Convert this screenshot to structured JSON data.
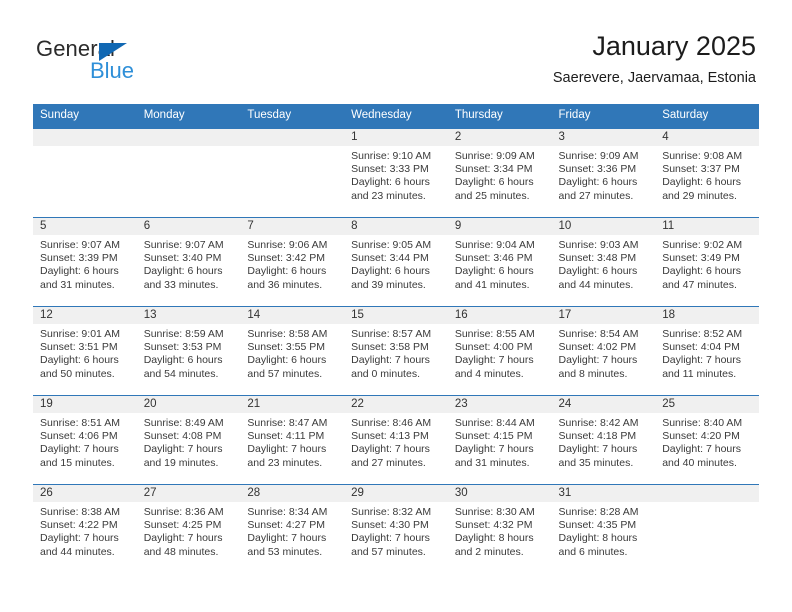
{
  "logo": {
    "text_top": "General",
    "text_bottom": "Blue",
    "triangle_color": "#1168b3",
    "blue_color": "#2e8fd8"
  },
  "header": {
    "title": "January 2025",
    "subtitle": "Saerevere, Jaervamaa, Estonia"
  },
  "theme": {
    "header_blue": "#3077b8",
    "daynum_band": "#f0f0f0",
    "text": "#3a3a3a"
  },
  "weekdays": [
    "Sunday",
    "Monday",
    "Tuesday",
    "Wednesday",
    "Thursday",
    "Friday",
    "Saturday"
  ],
  "labels": {
    "sunrise_prefix": "Sunrise:",
    "sunset_prefix": "Sunset:",
    "daylight_prefix": "Daylight:"
  },
  "weeks": [
    [
      {
        "day": "",
        "empty": true,
        "sunrise": "",
        "sunset": "",
        "daylight_line1": "",
        "daylight_line2": ""
      },
      {
        "day": "",
        "empty": true,
        "sunrise": "",
        "sunset": "",
        "daylight_line1": "",
        "daylight_line2": ""
      },
      {
        "day": "",
        "empty": true,
        "sunrise": "",
        "sunset": "",
        "daylight_line1": "",
        "daylight_line2": ""
      },
      {
        "day": "1",
        "empty": false,
        "sunrise": "Sunrise: 9:10 AM",
        "sunset": "Sunset: 3:33 PM",
        "daylight_line1": "Daylight: 6 hours",
        "daylight_line2": "and 23 minutes."
      },
      {
        "day": "2",
        "empty": false,
        "sunrise": "Sunrise: 9:09 AM",
        "sunset": "Sunset: 3:34 PM",
        "daylight_line1": "Daylight: 6 hours",
        "daylight_line2": "and 25 minutes."
      },
      {
        "day": "3",
        "empty": false,
        "sunrise": "Sunrise: 9:09 AM",
        "sunset": "Sunset: 3:36 PM",
        "daylight_line1": "Daylight: 6 hours",
        "daylight_line2": "and 27 minutes."
      },
      {
        "day": "4",
        "empty": false,
        "sunrise": "Sunrise: 9:08 AM",
        "sunset": "Sunset: 3:37 PM",
        "daylight_line1": "Daylight: 6 hours",
        "daylight_line2": "and 29 minutes."
      }
    ],
    [
      {
        "day": "5",
        "empty": false,
        "sunrise": "Sunrise: 9:07 AM",
        "sunset": "Sunset: 3:39 PM",
        "daylight_line1": "Daylight: 6 hours",
        "daylight_line2": "and 31 minutes."
      },
      {
        "day": "6",
        "empty": false,
        "sunrise": "Sunrise: 9:07 AM",
        "sunset": "Sunset: 3:40 PM",
        "daylight_line1": "Daylight: 6 hours",
        "daylight_line2": "and 33 minutes."
      },
      {
        "day": "7",
        "empty": false,
        "sunrise": "Sunrise: 9:06 AM",
        "sunset": "Sunset: 3:42 PM",
        "daylight_line1": "Daylight: 6 hours",
        "daylight_line2": "and 36 minutes."
      },
      {
        "day": "8",
        "empty": false,
        "sunrise": "Sunrise: 9:05 AM",
        "sunset": "Sunset: 3:44 PM",
        "daylight_line1": "Daylight: 6 hours",
        "daylight_line2": "and 39 minutes."
      },
      {
        "day": "9",
        "empty": false,
        "sunrise": "Sunrise: 9:04 AM",
        "sunset": "Sunset: 3:46 PM",
        "daylight_line1": "Daylight: 6 hours",
        "daylight_line2": "and 41 minutes."
      },
      {
        "day": "10",
        "empty": false,
        "sunrise": "Sunrise: 9:03 AM",
        "sunset": "Sunset: 3:48 PM",
        "daylight_line1": "Daylight: 6 hours",
        "daylight_line2": "and 44 minutes."
      },
      {
        "day": "11",
        "empty": false,
        "sunrise": "Sunrise: 9:02 AM",
        "sunset": "Sunset: 3:49 PM",
        "daylight_line1": "Daylight: 6 hours",
        "daylight_line2": "and 47 minutes."
      }
    ],
    [
      {
        "day": "12",
        "empty": false,
        "sunrise": "Sunrise: 9:01 AM",
        "sunset": "Sunset: 3:51 PM",
        "daylight_line1": "Daylight: 6 hours",
        "daylight_line2": "and 50 minutes."
      },
      {
        "day": "13",
        "empty": false,
        "sunrise": "Sunrise: 8:59 AM",
        "sunset": "Sunset: 3:53 PM",
        "daylight_line1": "Daylight: 6 hours",
        "daylight_line2": "and 54 minutes."
      },
      {
        "day": "14",
        "empty": false,
        "sunrise": "Sunrise: 8:58 AM",
        "sunset": "Sunset: 3:55 PM",
        "daylight_line1": "Daylight: 6 hours",
        "daylight_line2": "and 57 minutes."
      },
      {
        "day": "15",
        "empty": false,
        "sunrise": "Sunrise: 8:57 AM",
        "sunset": "Sunset: 3:58 PM",
        "daylight_line1": "Daylight: 7 hours",
        "daylight_line2": "and 0 minutes."
      },
      {
        "day": "16",
        "empty": false,
        "sunrise": "Sunrise: 8:55 AM",
        "sunset": "Sunset: 4:00 PM",
        "daylight_line1": "Daylight: 7 hours",
        "daylight_line2": "and 4 minutes."
      },
      {
        "day": "17",
        "empty": false,
        "sunrise": "Sunrise: 8:54 AM",
        "sunset": "Sunset: 4:02 PM",
        "daylight_line1": "Daylight: 7 hours",
        "daylight_line2": "and 8 minutes."
      },
      {
        "day": "18",
        "empty": false,
        "sunrise": "Sunrise: 8:52 AM",
        "sunset": "Sunset: 4:04 PM",
        "daylight_line1": "Daylight: 7 hours",
        "daylight_line2": "and 11 minutes."
      }
    ],
    [
      {
        "day": "19",
        "empty": false,
        "sunrise": "Sunrise: 8:51 AM",
        "sunset": "Sunset: 4:06 PM",
        "daylight_line1": "Daylight: 7 hours",
        "daylight_line2": "and 15 minutes."
      },
      {
        "day": "20",
        "empty": false,
        "sunrise": "Sunrise: 8:49 AM",
        "sunset": "Sunset: 4:08 PM",
        "daylight_line1": "Daylight: 7 hours",
        "daylight_line2": "and 19 minutes."
      },
      {
        "day": "21",
        "empty": false,
        "sunrise": "Sunrise: 8:47 AM",
        "sunset": "Sunset: 4:11 PM",
        "daylight_line1": "Daylight: 7 hours",
        "daylight_line2": "and 23 minutes."
      },
      {
        "day": "22",
        "empty": false,
        "sunrise": "Sunrise: 8:46 AM",
        "sunset": "Sunset: 4:13 PM",
        "daylight_line1": "Daylight: 7 hours",
        "daylight_line2": "and 27 minutes."
      },
      {
        "day": "23",
        "empty": false,
        "sunrise": "Sunrise: 8:44 AM",
        "sunset": "Sunset: 4:15 PM",
        "daylight_line1": "Daylight: 7 hours",
        "daylight_line2": "and 31 minutes."
      },
      {
        "day": "24",
        "empty": false,
        "sunrise": "Sunrise: 8:42 AM",
        "sunset": "Sunset: 4:18 PM",
        "daylight_line1": "Daylight: 7 hours",
        "daylight_line2": "and 35 minutes."
      },
      {
        "day": "25",
        "empty": false,
        "sunrise": "Sunrise: 8:40 AM",
        "sunset": "Sunset: 4:20 PM",
        "daylight_line1": "Daylight: 7 hours",
        "daylight_line2": "and 40 minutes."
      }
    ],
    [
      {
        "day": "26",
        "empty": false,
        "sunrise": "Sunrise: 8:38 AM",
        "sunset": "Sunset: 4:22 PM",
        "daylight_line1": "Daylight: 7 hours",
        "daylight_line2": "and 44 minutes."
      },
      {
        "day": "27",
        "empty": false,
        "sunrise": "Sunrise: 8:36 AM",
        "sunset": "Sunset: 4:25 PM",
        "daylight_line1": "Daylight: 7 hours",
        "daylight_line2": "and 48 minutes."
      },
      {
        "day": "28",
        "empty": false,
        "sunrise": "Sunrise: 8:34 AM",
        "sunset": "Sunset: 4:27 PM",
        "daylight_line1": "Daylight: 7 hours",
        "daylight_line2": "and 53 minutes."
      },
      {
        "day": "29",
        "empty": false,
        "sunrise": "Sunrise: 8:32 AM",
        "sunset": "Sunset: 4:30 PM",
        "daylight_line1": "Daylight: 7 hours",
        "daylight_line2": "and 57 minutes."
      },
      {
        "day": "30",
        "empty": false,
        "sunrise": "Sunrise: 8:30 AM",
        "sunset": "Sunset: 4:32 PM",
        "daylight_line1": "Daylight: 8 hours",
        "daylight_line2": "and 2 minutes."
      },
      {
        "day": "31",
        "empty": false,
        "sunrise": "Sunrise: 8:28 AM",
        "sunset": "Sunset: 4:35 PM",
        "daylight_line1": "Daylight: 8 hours",
        "daylight_line2": "and 6 minutes."
      },
      {
        "day": "",
        "empty": true,
        "sunrise": "",
        "sunset": "",
        "daylight_line1": "",
        "daylight_line2": ""
      }
    ]
  ]
}
